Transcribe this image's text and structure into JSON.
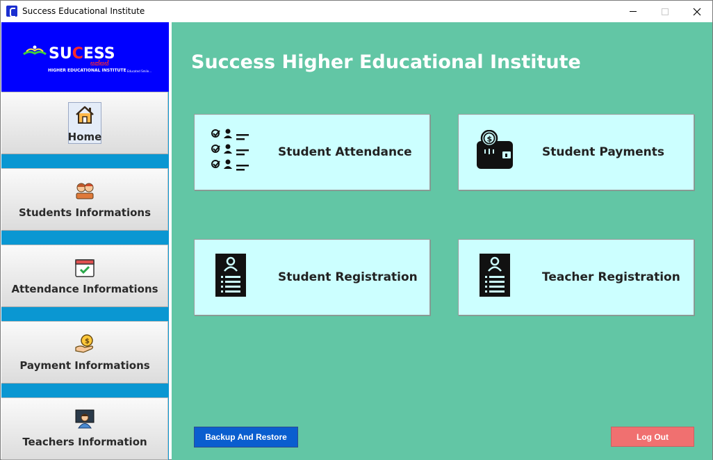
{
  "window": {
    "title": "Success Educational Institute"
  },
  "logo": {
    "main_pre": "SU",
    "main_c": "C",
    "main_post": "ESS",
    "sinhala": "සක්සස්",
    "subtitle": "HIGHER EDUCATIONAL INSTITUTE",
    "tagline": "Educated Smile..."
  },
  "sidebar": {
    "items": [
      {
        "label": "Home",
        "icon": "home-icon"
      },
      {
        "label": "Students Informations",
        "icon": "students-icon"
      },
      {
        "label": "Attendance Informations",
        "icon": "calendar-check-icon"
      },
      {
        "label": "Payment Informations",
        "icon": "hand-coin-icon"
      },
      {
        "label": "Teachers Information",
        "icon": "teacher-icon"
      }
    ]
  },
  "main": {
    "title": "Success Higher Educational Institute",
    "cards": [
      {
        "label": "Student Attendance",
        "icon": "checklist-icon"
      },
      {
        "label": "Student Payments",
        "icon": "wallet-icon"
      },
      {
        "label": "Student Registration",
        "icon": "registration-form-icon"
      },
      {
        "label": "Teacher Registration",
        "icon": "registration-form-icon"
      }
    ],
    "backup_label": "Backup And Restore",
    "logout_label": "Log Out"
  },
  "colors": {
    "sidebar_accent": "#0a97d2",
    "logo_bg": "#0000ff",
    "main_bg": "#62c6a5",
    "card_bg": "#ccffff",
    "backup_btn": "#0a5ecf",
    "logout_btn": "#f07070"
  }
}
